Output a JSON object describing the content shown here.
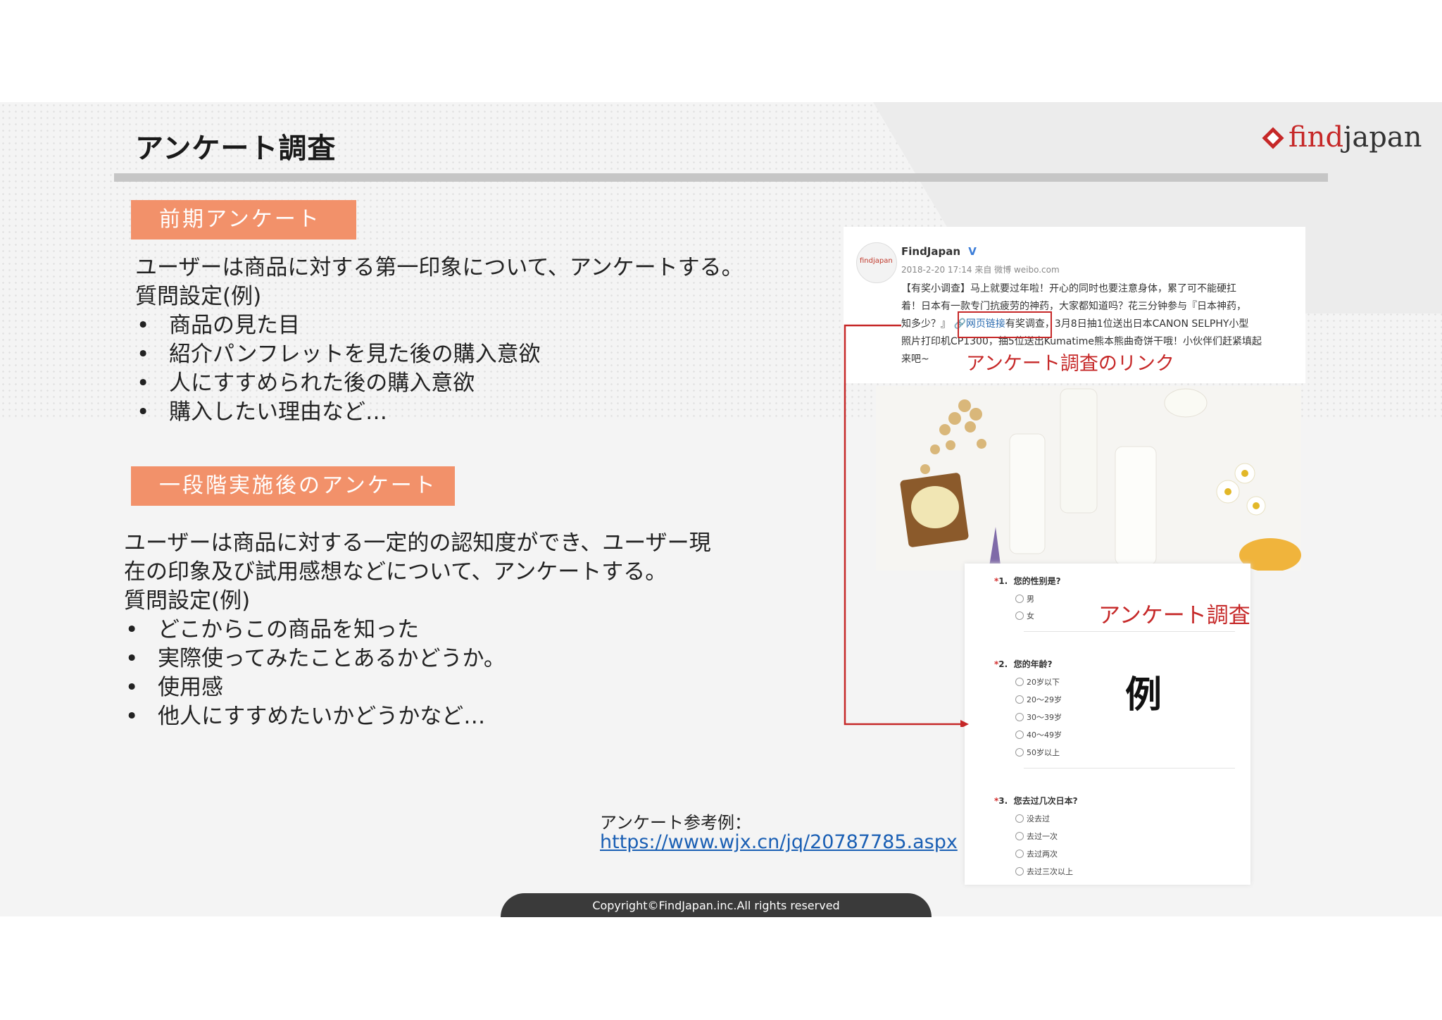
{
  "page": {
    "title": "アンケート調査",
    "logo_text": "findjapan"
  },
  "section1": {
    "badge": "前期アンケート",
    "intro": "ユーザーは商品に対する第一印象について、アンケートする。",
    "questions_label": "質問設定(例)",
    "items": [
      "商品の見た目",
      "紹介パンフレットを見た後の購入意欲",
      "人にすすめられた後の購入意欲",
      "購入したい理由など…"
    ]
  },
  "section2": {
    "badge": "一段階実施後のアンケート",
    "intro_line1": "ユーザーは商品に対する一定的の認知度ができ、ユーザー現",
    "intro_line2": "在の印象及び試用感想などについて、アンケートする。",
    "questions_label": "質問設定(例)",
    "items": [
      "どこからこの商品を知った",
      "実際使ってみたことあるかどうか。",
      "使用感",
      "他人にすすめたいかどうかなど…"
    ]
  },
  "weibo": {
    "avatar_text": "findjapan",
    "account": "FindJapan",
    "meta": "2018-2-20 17:14 来自 微博 weibo.com",
    "line1": "【有奖小调查】马上就要过年啦！开心的同时也要注意身体，累了可不能硬扛",
    "line2": "着！日本有一款专门抗疲劳的神药，大家都知道吗？花三分钟参与『日本神药，",
    "line3_pre": "知多少？』",
    "link_text": "网页链接",
    "line3_post": "有奖调查，3月8日抽1位送出日本CANON SELPHY小型",
    "line4": "照片打印机CP1300，抽5位送出Kumatime熊本熊曲奇饼干哦！小伙伴们赶紧填起",
    "line5": "来吧~",
    "link_caption": "アンケート調査のリンク"
  },
  "survey": {
    "label": "アンケート調査",
    "example": "例",
    "q1": {
      "num": "1.",
      "text": "您的性别是?",
      "options": [
        "男",
        "女"
      ]
    },
    "q2": {
      "num": "2.",
      "text": "您的年龄?",
      "options": [
        "20岁以下",
        "20～29岁",
        "30～39岁",
        "40～49岁",
        "50岁以上"
      ]
    },
    "q3": {
      "num": "3.",
      "text": "您去过几次日本?",
      "options": [
        "没去过",
        "去过一次",
        "去过两次",
        "去过三次以上"
      ]
    }
  },
  "reference": {
    "label": "アンケート参考例：",
    "url": "https://www.wjx.cn/jq/20787785.aspx"
  },
  "footer": {
    "copyright": "Copyright©FindJapan.inc.All rights reserved"
  },
  "colors": {
    "badge": "#f2916a",
    "accent_red": "#c62828",
    "link_blue": "#1a5fb4",
    "rule_gray": "#c6c6c6"
  }
}
